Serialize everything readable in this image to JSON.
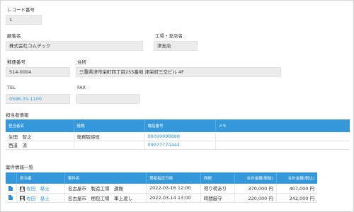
{
  "record": {
    "label": "レコード番号",
    "value": "1"
  },
  "customer": {
    "label": "顧客名",
    "value": "株式会社コムデック"
  },
  "branch": {
    "label": "工場・支店名",
    "value": "津支店"
  },
  "postal": {
    "label": "郵便番号",
    "value": "514-0004"
  },
  "address": {
    "label": "住所",
    "value": "三重県津市栄町四丁目255番地 津栄町三交ビル 4F"
  },
  "tel": {
    "label": "TEL",
    "value": "0596-31-1100"
  },
  "fax": {
    "label": "FAX",
    "value": ""
  },
  "contacts": {
    "section_title": "担当者情報",
    "headers": [
      "担当者名",
      "役職",
      "電話番号",
      "メモ"
    ],
    "rows": [
      {
        "name": "生田　智之",
        "position": "専務取締役",
        "phone": "08099998888",
        "memo": ""
      },
      {
        "name": "西道　涼",
        "position": "",
        "phone": "09077774444",
        "memo": ""
      }
    ]
  },
  "deals": {
    "section_title": "案件情報一覧",
    "headers": [
      "担当者",
      "案件名",
      "買者指定日時",
      "詳細",
      "合計金額(税抜)",
      "合計金額(税込)"
    ],
    "rows": [
      {
        "owner": "佐田　基士",
        "name": "名古屋市　製造工場　運搬",
        "date": "2022-03-16 12:00",
        "detail": "得り荷あり",
        "total_ex": "370,000 円",
        "total_in": "407,000 円"
      },
      {
        "owner": "佐田　基士",
        "name": "名古屋市　梱包工場　車上渡し",
        "date": "2022-03-14 13:00",
        "detail": "時間厳守",
        "total_ex": "220,000 円",
        "total_in": "242,000 円"
      }
    ]
  },
  "colors": {
    "header_blue": "#3498db",
    "link_blue": "#3498db",
    "field_gray": "#ececec"
  }
}
